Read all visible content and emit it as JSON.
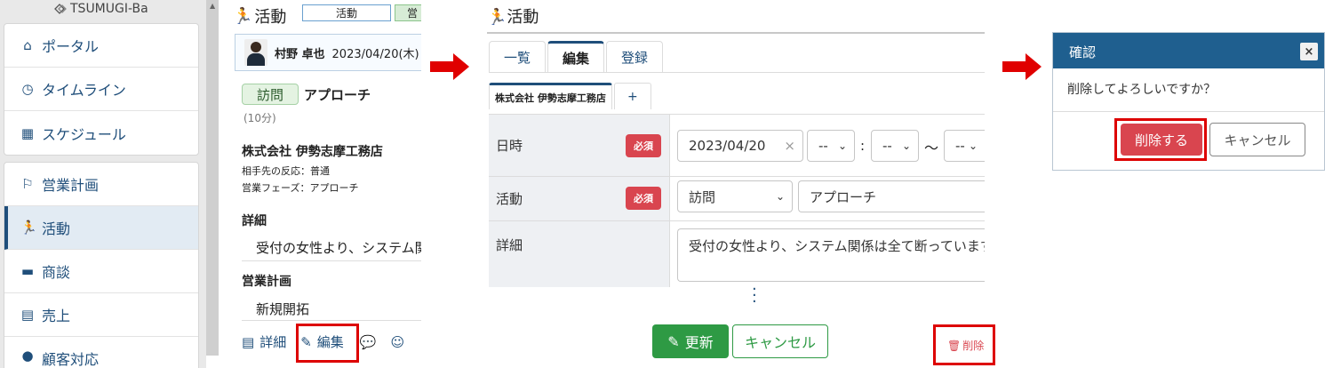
{
  "panel1": {
    "logo_text": "TSUMUGI-Ba",
    "nav_group1": [
      {
        "icon": "home-icon",
        "glyph": "⌂",
        "label": "ポータル"
      },
      {
        "icon": "clock-icon",
        "glyph": "◷",
        "label": "タイムライン"
      },
      {
        "icon": "calendar-icon",
        "glyph": "▦",
        "label": "スケジュール"
      }
    ],
    "nav_group2": [
      {
        "icon": "flag-icon",
        "glyph": "⚐",
        "label": "営業計画"
      },
      {
        "icon": "running-icon",
        "glyph": "🏃",
        "label": "活動",
        "active": true
      },
      {
        "icon": "briefcase-icon",
        "glyph": "▬",
        "label": "商談"
      },
      {
        "icon": "invoice-icon",
        "glyph": "▤",
        "label": "売上"
      },
      {
        "icon": "person-icon",
        "glyph": "●",
        "label": "顧客対応"
      }
    ],
    "header_title": "活動",
    "header_chip1": "活動",
    "header_chip2": "営",
    "user_name": "村野 卓也",
    "date": "2023/04/20(木)",
    "visit_badge": "訪問",
    "activity_name": "アプローチ",
    "duration": "(10分)",
    "company": "株式会社 伊勢志摩工務店",
    "reaction": "相手先の反応：普通",
    "phase": "営業フェーズ：アプローチ",
    "detail_heading": "詳細",
    "detail_text": "受付の女性より、システム関係は全て断っています",
    "plan_heading": "営業計画",
    "plan_text": "新規開拓",
    "action_detail": "詳細",
    "action_edit": "編集"
  },
  "panel2": {
    "header_title": "活動",
    "tabs": [
      "一覧",
      "編集",
      "登録"
    ],
    "subtab_company": "株式会社 伊勢志摩工務店",
    "subtab_plus": "+",
    "row_datetime_label": "日時",
    "required_label": "必須",
    "date_value": "2023/04/20",
    "date_clear": "×",
    "hour_value": "--",
    "minute_value": "--",
    "colon": ":",
    "tilde": "〜",
    "end_hour_value": "--",
    "row_activity_label": "活動",
    "activity_type": "訪問",
    "activity_name": "アプローチ",
    "row_detail_label": "詳細",
    "detail_text": "受付の女性より、システム関係は全て断っています",
    "btn_update": "更新",
    "btn_cancel": "キャンセル",
    "delete_link": "削除"
  },
  "panel3": {
    "dialog_title": "確認",
    "dialog_close": "×",
    "message": "削除してよろしいですか？",
    "btn_delete": "削除する",
    "btn_cancel": "キャンセル"
  },
  "colors": {
    "brand_navy": "#1f4e7a",
    "highlight_red": "#dd0000",
    "update_green": "#2e9a44",
    "danger_red": "#d9454f",
    "dialog_header": "#1f5f8f"
  }
}
